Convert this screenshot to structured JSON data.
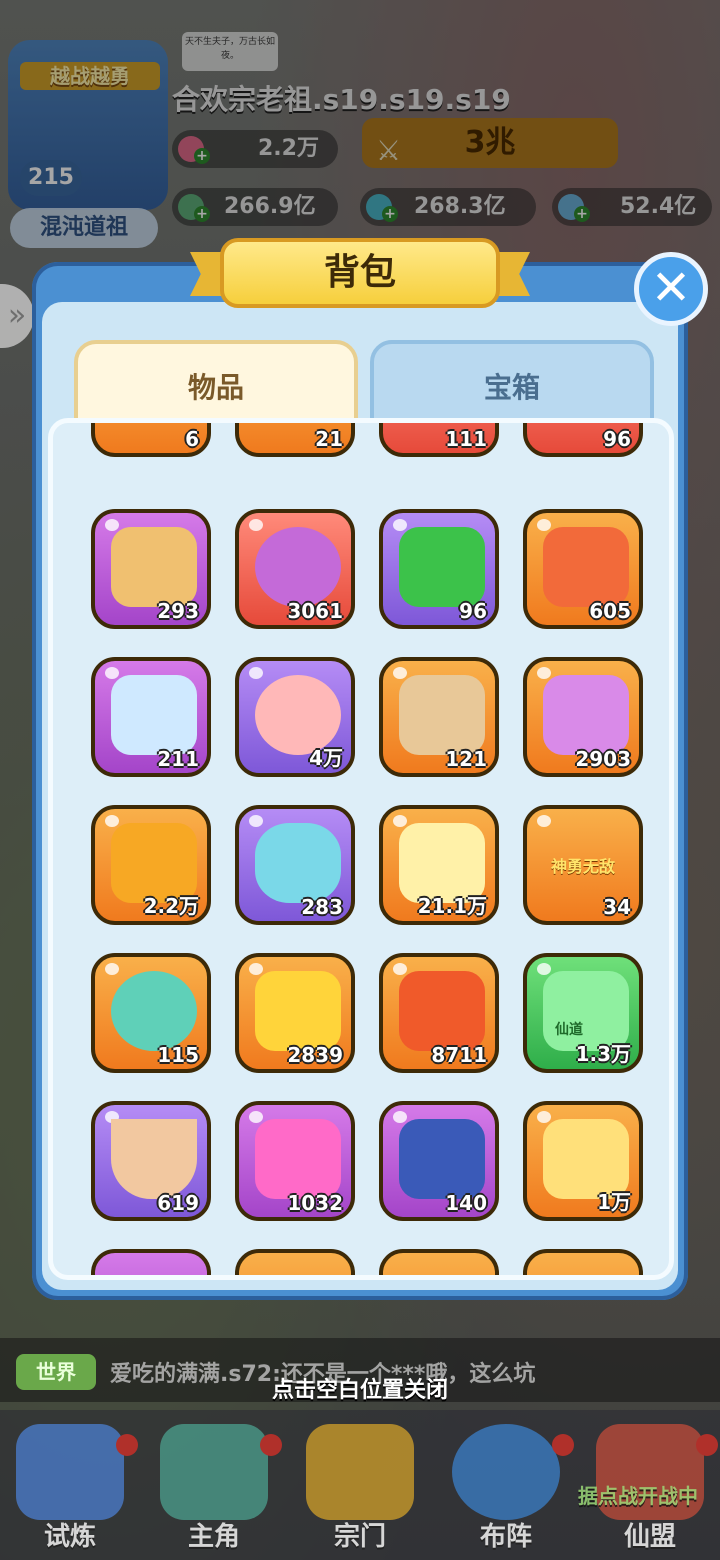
{
  "hud": {
    "avatar_title": "越战越勇",
    "level": "215",
    "rank": "混沌道祖",
    "player_name": "合欢宗老祖.s19.s19.s19",
    "speech": "天不生夫子，万古长如夜。",
    "stamina": "2.2万",
    "power": "3兆",
    "resources": [
      "266.9亿",
      "268.3亿",
      "52.4亿"
    ]
  },
  "panel": {
    "title": "背包",
    "close_icon": "✕",
    "tabs": [
      {
        "label": "物品",
        "active": true
      },
      {
        "label": "宝箱",
        "active": false
      }
    ]
  },
  "items": {
    "partial_top": [
      "6",
      "21",
      "111",
      "96"
    ],
    "rows": [
      [
        "293",
        "3061",
        "96",
        "605"
      ],
      [
        "211",
        "4万",
        "121",
        "2903"
      ],
      [
        "2.2万",
        "283",
        "21.1万",
        "34"
      ],
      [
        "115",
        "2839",
        "8711",
        "1.3万"
      ],
      [
        "619",
        "1032",
        "140",
        "1万"
      ]
    ],
    "badge_text": "神勇无敌",
    "ticket_text": "仙道"
  },
  "chat": {
    "channel": "世界",
    "message": "爱吃的满满.s72:还不是一个***哦，这么坑"
  },
  "close_hint": "点击空白位置关闭",
  "nav": {
    "items": [
      "试炼",
      "主角",
      "宗门",
      "布阵",
      "仙盟"
    ],
    "event_label": "据点战开战中"
  }
}
